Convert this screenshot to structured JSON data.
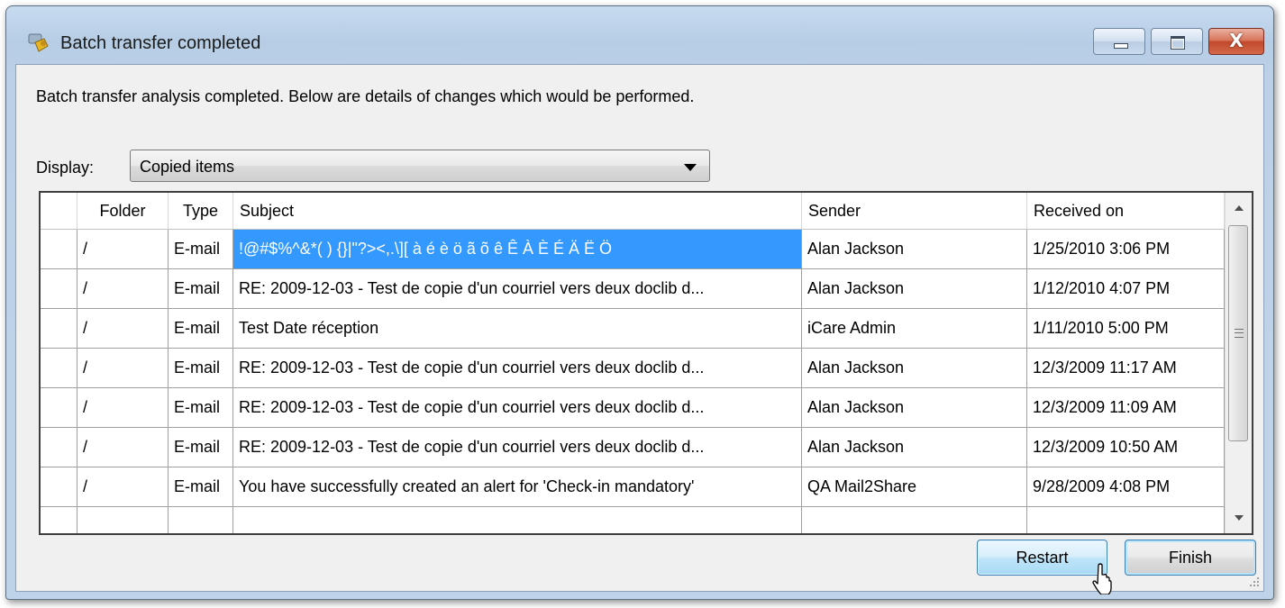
{
  "window": {
    "title": "Batch transfer completed",
    "caption_buttons": {
      "close_glyph": "X"
    }
  },
  "description": "Batch transfer analysis completed. Below are details of changes which would be performed.",
  "display": {
    "label": "Display:",
    "selected": "Copied items"
  },
  "grid": {
    "columns": [
      "Folder",
      "Type",
      "Subject",
      "Sender",
      "Received on"
    ],
    "rows": [
      {
        "folder": "/",
        "type": "E-mail",
        "subject": "!@#$%^&*( ) {}|\"?><,.\\][ à é è ö ã õ ê Ê À È É Ä Ë Ö",
        "sender": "Alan Jackson",
        "received": "1/25/2010 3:06 PM"
      },
      {
        "folder": "/",
        "type": "E-mail",
        "subject": "RE: 2009-12-03 - Test de copie d'un courriel vers deux doclib d...",
        "sender": "Alan Jackson",
        "received": "1/12/2010 4:07 PM"
      },
      {
        "folder": "/",
        "type": "E-mail",
        "subject": "Test Date réception",
        "sender": "iCare Admin",
        "received": "1/11/2010 5:00 PM"
      },
      {
        "folder": "/",
        "type": "E-mail",
        "subject": "RE: 2009-12-03 - Test de copie d'un courriel vers deux doclib d...",
        "sender": "Alan Jackson",
        "received": "12/3/2009 11:17 AM"
      },
      {
        "folder": "/",
        "type": "E-mail",
        "subject": "RE: 2009-12-03 - Test de copie d'un courriel vers deux doclib d...",
        "sender": "Alan Jackson",
        "received": "12/3/2009 11:09 AM"
      },
      {
        "folder": "/",
        "type": "E-mail",
        "subject": "RE: 2009-12-03 - Test de copie d'un courriel vers deux doclib d...",
        "sender": "Alan Jackson",
        "received": "12/3/2009 10:50 AM"
      },
      {
        "folder": "/",
        "type": "E-mail",
        "subject": "You have successfully created an alert for 'Check-in mandatory'",
        "sender": "QA Mail2Share",
        "received": "9/28/2009 4:08 PM"
      },
      {
        "folder": "",
        "type": "",
        "subject": "",
        "sender": "",
        "received": ""
      }
    ],
    "selected_cell": {
      "row": 0,
      "column": "subject",
      "color": "#3399ff"
    }
  },
  "buttons": {
    "restart": "Restart",
    "finish": "Finish"
  }
}
